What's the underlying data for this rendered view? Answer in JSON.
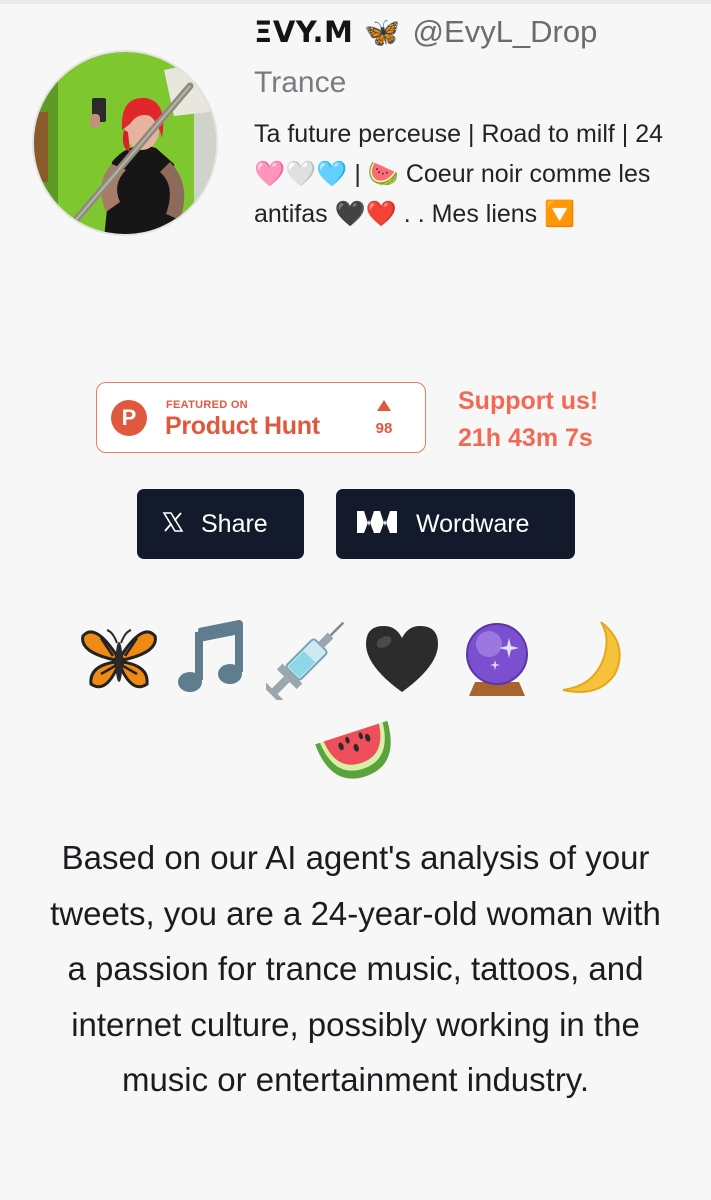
{
  "profile": {
    "display_name": "ΞVY.M 🦋",
    "handle": "@EvyL_Drop",
    "category": "Trance",
    "bio": "Ta future perceuse | Road to milf | 24 🩷🤍🩵 | 🍉 Coeur noir comme les antifas 🖤❤️ . . Mes liens 🔽",
    "avatar_icon": "profile-photo"
  },
  "product_hunt": {
    "featured_label": "FEATURED ON",
    "name": "Product Hunt",
    "logo_letter": "P",
    "upvotes": "98",
    "accent_color": "#e0583d"
  },
  "support": {
    "label": "Support us!",
    "countdown": "21h 43m 7s",
    "color": "#f26a55"
  },
  "buttons": {
    "share_label": "Share",
    "share_icon": "x-logo-icon",
    "wordware_label": "Wordware",
    "wordware_icon": "wordware-logo-icon",
    "background": "#121a2b"
  },
  "emojis": [
    {
      "name": "butterfly",
      "char": "🦋"
    },
    {
      "name": "musical-note",
      "char": "🎵"
    },
    {
      "name": "syringe",
      "char": "💉"
    },
    {
      "name": "black-heart",
      "char": "🖤"
    },
    {
      "name": "crystal-ball",
      "char": "🔮"
    },
    {
      "name": "crescent-moon",
      "char": "🌙"
    },
    {
      "name": "watermelon",
      "char": "🍉"
    }
  ],
  "analysis": "Based on our AI agent's analysis of your tweets, you are a 24-year-old woman with a passion for trance music, tattoos, and internet culture, possibly working in the music or entertainment industry."
}
